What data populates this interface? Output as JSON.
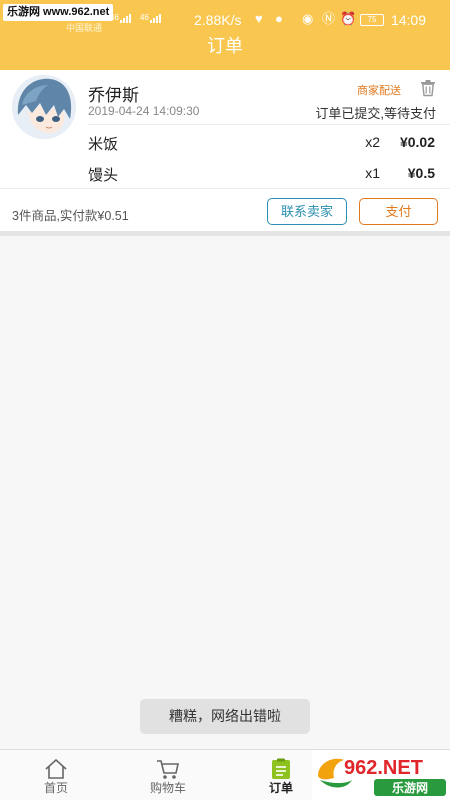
{
  "status_bar": {
    "watermark": "乐游网 www.962.net",
    "carrier": "中国联通",
    "signal_1": "46",
    "signal_2": "46",
    "speed": "2.88K/s",
    "battery": "75",
    "time": "14:09"
  },
  "header": {
    "title": "订单"
  },
  "order": {
    "shop_name": "乔伊斯",
    "time": "2019-04-24 14:09:30",
    "delivery_tag": "商家配送",
    "status": "订单已提交,等待支付",
    "items": [
      {
        "name": "米饭",
        "qty": "x2",
        "price": "¥0.02"
      },
      {
        "name": "馒头",
        "qty": "x1",
        "price": "¥0.5"
      }
    ],
    "summary": "3件商品,实付款¥0.51",
    "contact_label": "联系卖家",
    "pay_label": "支付"
  },
  "toast": {
    "message": "糟糕，网络出错啦"
  },
  "tabbar": {
    "tabs": [
      {
        "label": "首页",
        "icon": "home-icon"
      },
      {
        "label": "购物车",
        "icon": "cart-icon"
      },
      {
        "label": "订单",
        "icon": "order-list-icon",
        "active": true
      }
    ]
  },
  "logo": {
    "text": "962.NET",
    "subtext": "乐游网"
  },
  "colors": {
    "brand_yellow": "#f9c74f",
    "accent_orange": "#e07a1f",
    "accent_blue": "#2a8fb0",
    "active_tab_green": "#8dc21f"
  }
}
